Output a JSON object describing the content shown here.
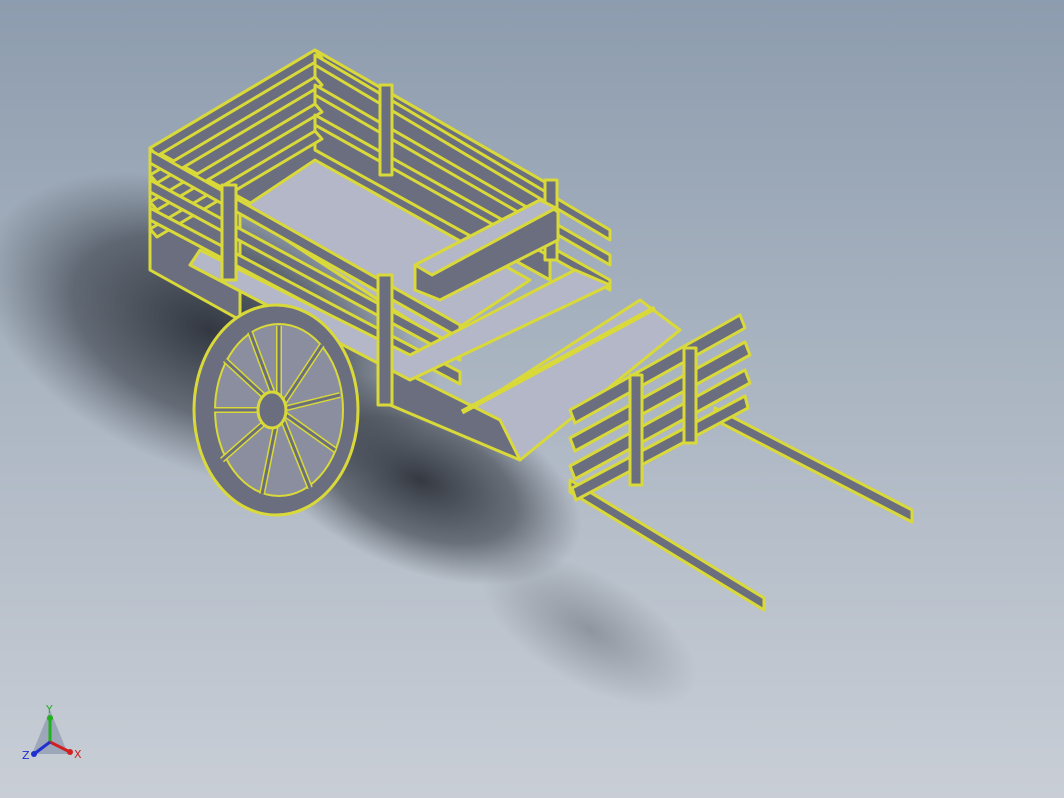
{
  "viewport": {
    "background_top": "#8d9cae",
    "background_bottom": "#c9ced6"
  },
  "model": {
    "body_color": "#6a6e7e",
    "edge_color": "#d9d93a",
    "light_face": "#b4b7c8"
  },
  "triad": {
    "x_label": "X",
    "y_label": "Y",
    "z_label": "Z",
    "x_color": "#d02020",
    "y_color": "#20b020",
    "z_color": "#2030d0"
  }
}
